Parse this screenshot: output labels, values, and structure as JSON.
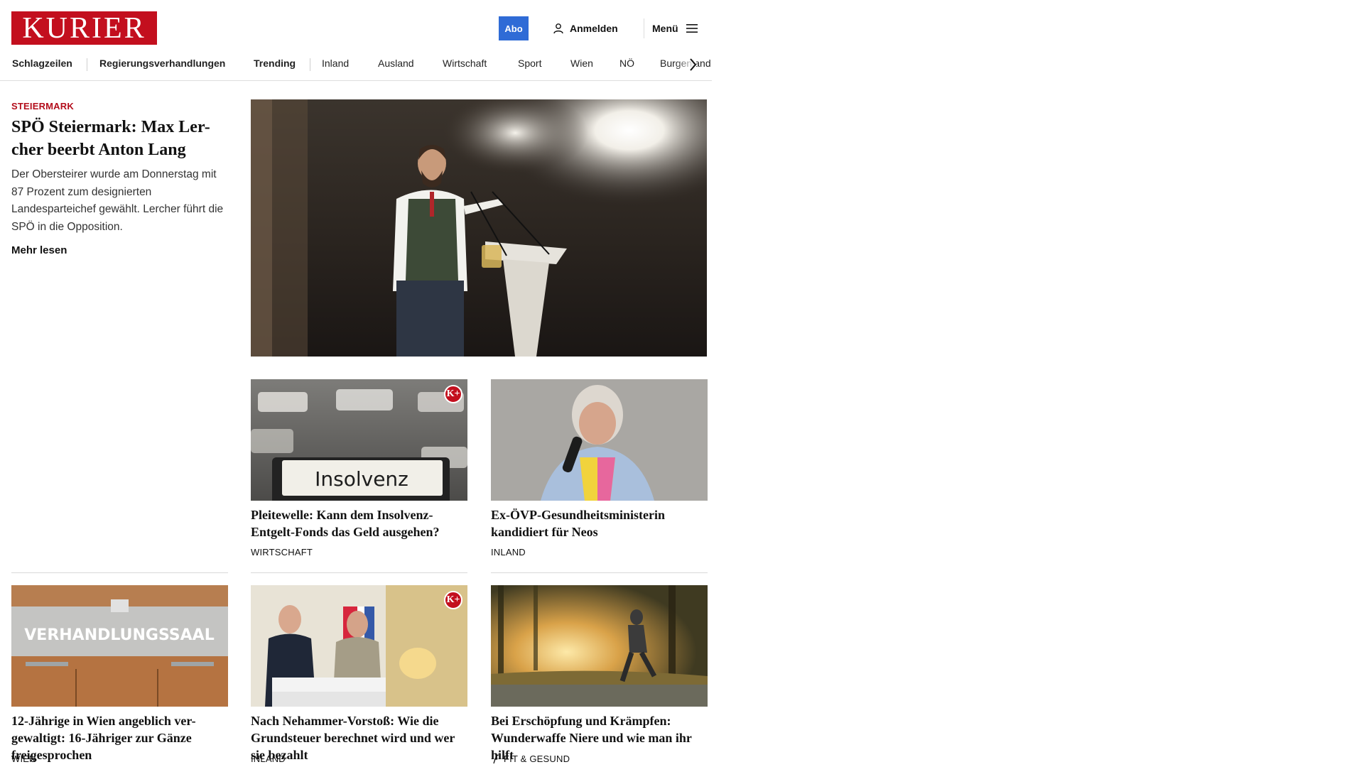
{
  "header": {
    "logo_text": "KURIER",
    "abo_label": "Abo",
    "login_label": "Anmelden",
    "menu_label": "Menü"
  },
  "nav": {
    "items": [
      "Schlagzeilen",
      "Regierungsverhandlungen",
      "Trending",
      "Inland",
      "Ausland",
      "Wirtschaft",
      "Sport",
      "Wien",
      "NÖ",
      "Burgenland"
    ]
  },
  "lead": {
    "kicker": "STEIERMARK",
    "title": "SPÖ Steiermark: Max Ler-cher beerbt Anton Lang",
    "teaser": "Der Obersteirer wurde am Donnerstag mit 87 Prozent zum designierten Landesparteichef gewählt. Lercher führt die SPÖ in die Opposition.",
    "more_label": "Mehr lesen"
  },
  "articles": [
    {
      "title": "Pleitewelle: Kann dem Insolvenz-Entgelt-Fonds das Geld ausgehen?",
      "category": "WIRTSCHAFT",
      "premium": true,
      "image_text": "Insolvenz"
    },
    {
      "title": "Ex-ÖVP-Gesundheitsministerin kandidiert für Neos",
      "category": "INLAND",
      "premium": false
    },
    {
      "title": "12-Jährige in Wien angeblich ver-gewaltigt: 16-Jähriger zur Gänze freigesprochen",
      "category": "WIEN",
      "premium": false,
      "image_text": "VERHANDLUNGSSAAL"
    },
    {
      "title": "Nach Nehammer-Vorstoß: Wie die Grundsteuer berechnet wird und wer sie bezahlt",
      "category": "INLAND",
      "premium": true
    },
    {
      "title": "Bei Erschöpfung und Krämpfen: Wunderwaffe Niere und wie man ihr hilft",
      "category": "FIT & GESUND",
      "premium": false
    }
  ],
  "badge_label": "K+",
  "colors": {
    "brand_red": "#c30f1e",
    "abo_blue": "#2f6bd6",
    "kicker_red": "#b30d1b"
  }
}
